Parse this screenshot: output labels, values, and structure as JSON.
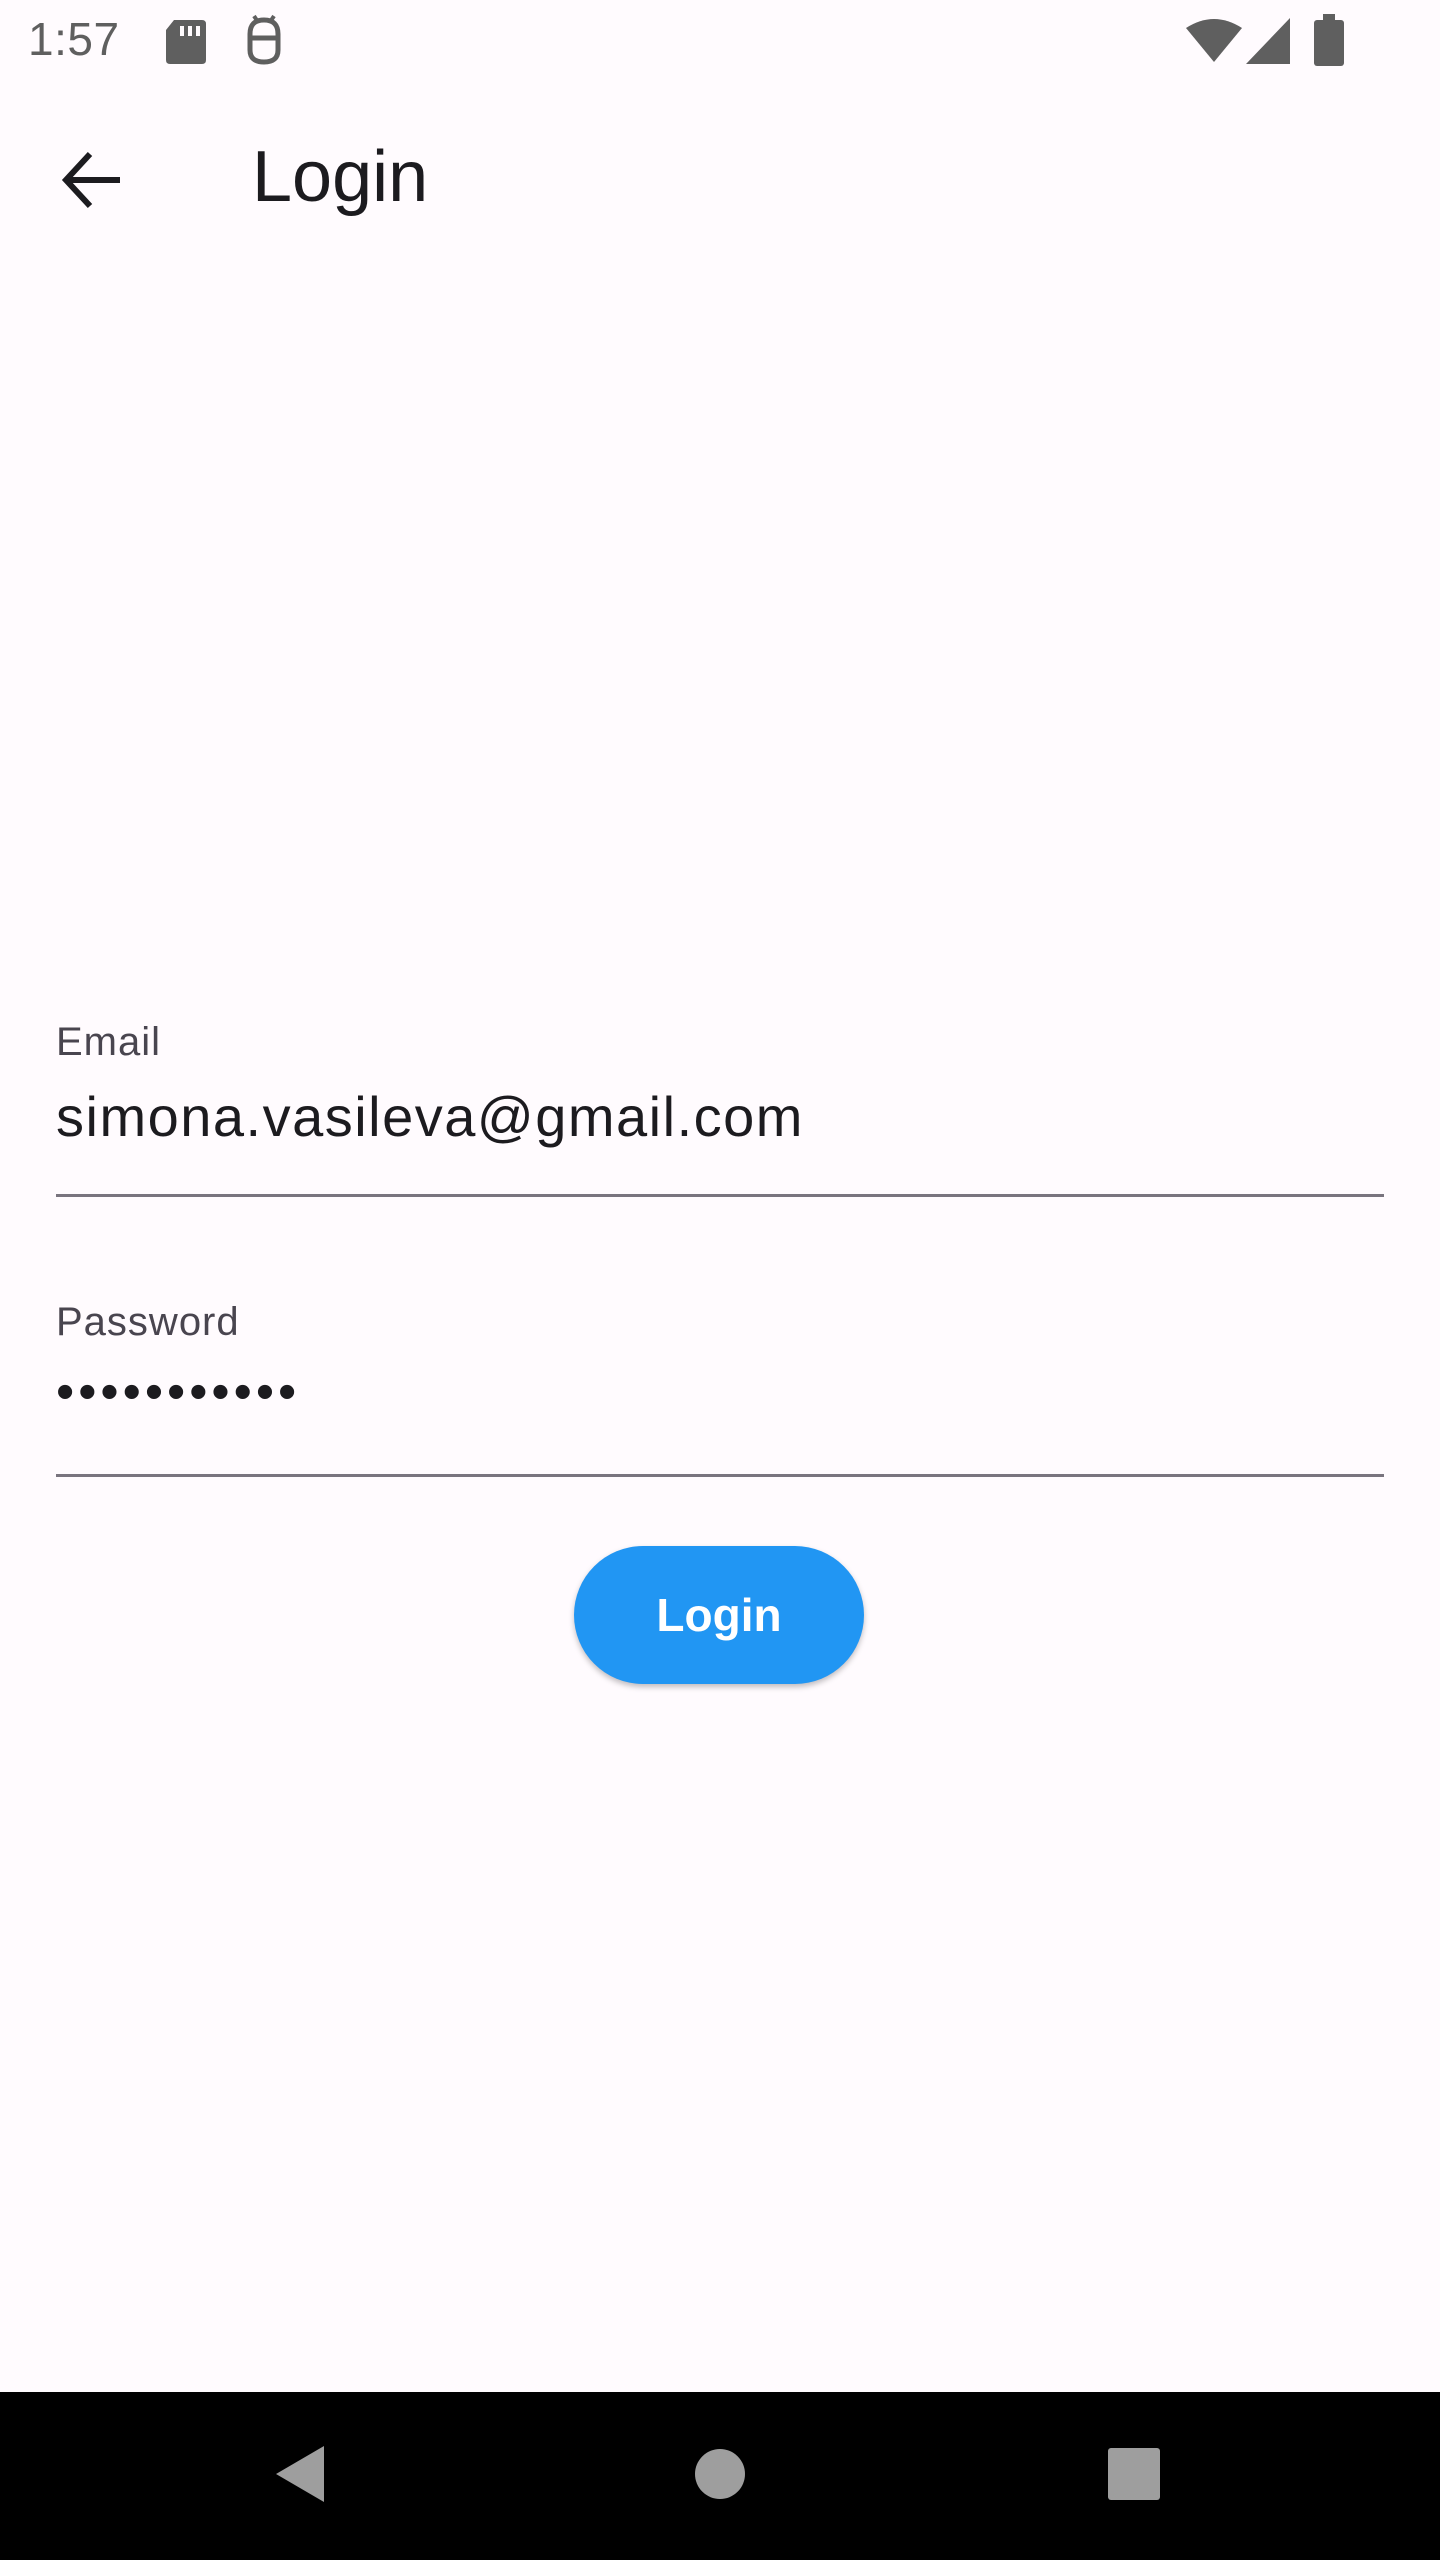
{
  "status_bar": {
    "time": "1:57",
    "icons": [
      "sd-card-icon",
      "android-debug-icon",
      "wifi-icon",
      "signal-icon",
      "battery-icon"
    ]
  },
  "app_bar": {
    "title": "Login",
    "back_icon": "arrow-back-icon"
  },
  "form": {
    "email": {
      "label": "Email",
      "value": "simona.vasileva@gmail.com"
    },
    "password": {
      "label": "Password",
      "value": "•••••••••••"
    },
    "login_button_label": "Login"
  },
  "nav_bar": {
    "icons": [
      "back-triangle-icon",
      "home-circle-icon",
      "recents-square-icon"
    ]
  },
  "colors": {
    "background": "#fffbfe",
    "primary": "#2196f3",
    "text": "#1c1b1f",
    "label": "#49454f",
    "underline": "#79747e",
    "nav_bar": "#000000"
  }
}
